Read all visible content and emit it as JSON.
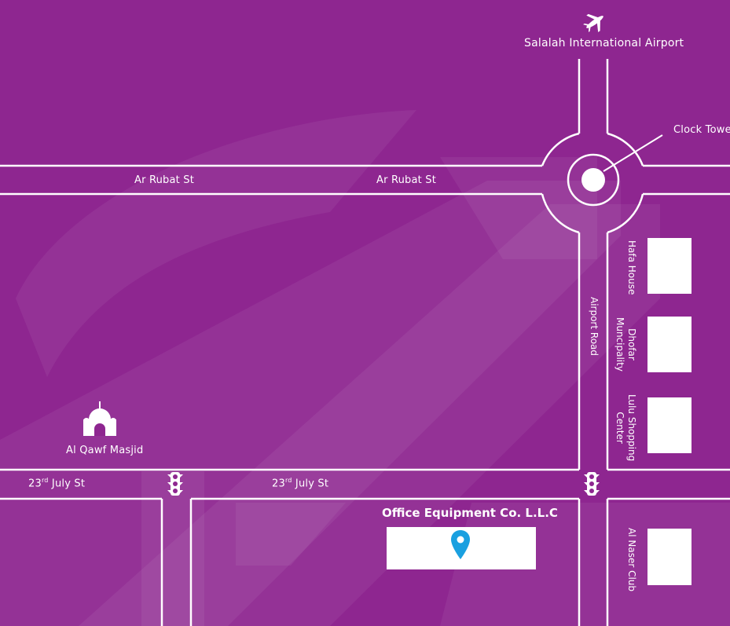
{
  "colors": {
    "background": "#8e2690",
    "road_line": "#ffffff",
    "pin": "#1aa0e0"
  },
  "labels": {
    "airport": "Salalah International Airport",
    "clock_tower": "Clock Towe",
    "ar_rubat_left": "Ar Rubat St",
    "ar_rubat_right": "Ar Rubat St",
    "airport_road": "Airport Road",
    "hafa_house": "Hafa House",
    "dhofar_line1": "Dhofar",
    "dhofar_line2": "Muncipality",
    "lulu_line1": "Lulu Shopping",
    "lulu_line2": "Center",
    "al_naser": "Al Naser Club",
    "masjid": "Al Qawf Masjid",
    "july_left_pre": "23",
    "july_left_sup": "rd",
    "july_left_post": " July St",
    "july_right_pre": "23",
    "july_right_sup": "rd",
    "july_right_post": " July St",
    "office": "Office Equipment Co. L.L.C"
  },
  "icons": {
    "airport": "airplane-icon",
    "masjid": "mosque-icon",
    "traffic_light_left": "traffic-light-icon",
    "traffic_light_right": "traffic-light-icon",
    "location": "map-pin-icon"
  }
}
